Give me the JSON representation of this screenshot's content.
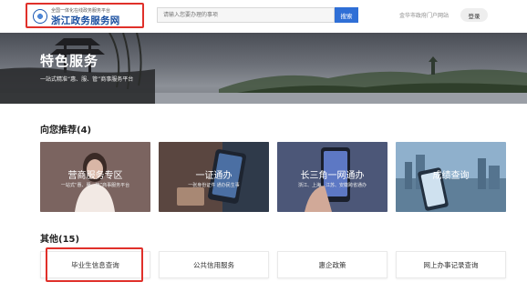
{
  "header": {
    "logo_sub": "全国一体化在线政务服务平台",
    "logo_title": "浙江政务服务网",
    "search_placeholder": "请输入您要办理的事项",
    "search_button": "搜索",
    "portal_link": "金华市政府门户网站",
    "login": "登录"
  },
  "banner": {
    "title": "特色服务",
    "subtitle": "一站式精准“惠、服、管”商事服务平台"
  },
  "recommended": {
    "title": "向您推荐(4)",
    "cards": [
      {
        "title": "营商服务专区",
        "subtitle": "一站式“惠、服、管”商事服务平台"
      },
      {
        "title": "一证通办",
        "subtitle": "一张身份证件 通办民生事"
      },
      {
        "title": "长三角一网通办",
        "subtitle": "浙江、上海、江苏、安徽跨省通办"
      },
      {
        "title": "成绩查询",
        "subtitle": ""
      }
    ]
  },
  "others": {
    "title": "其他(15)",
    "items": [
      "毕业生信息查询",
      "公共信用服务",
      "惠企政策",
      "网上办事记录查询"
    ]
  },
  "colors": {
    "highlight": "#e0302a",
    "brand_blue": "#1a4fa0",
    "search_blue": "#2f6fd6"
  }
}
